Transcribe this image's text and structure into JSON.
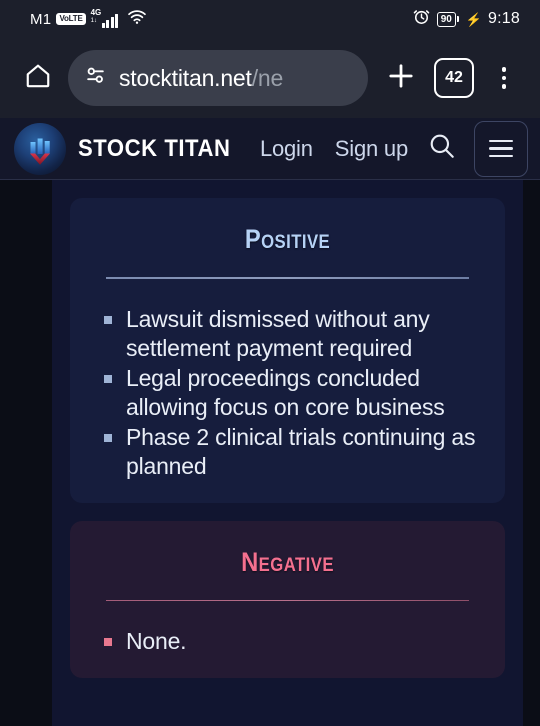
{
  "status_bar": {
    "carrier": "M1",
    "volte_badge": "VoLTE",
    "network_type": "4G",
    "network_sub": "1↓",
    "alarm_icon": "alarm-icon",
    "wifi_icon": "wifi-icon",
    "battery_level": "90",
    "charging_icon": "charging-bolt-icon",
    "time": "9:18"
  },
  "browser": {
    "home_icon": "home-icon",
    "site_settings_icon": "tune-icon",
    "url_main": "stocktitan.net",
    "url_dim": "/ne",
    "url_full": "stocktitan.net/ne",
    "new_tab_icon": "plus-icon",
    "tab_count": "42",
    "overflow_menu_icon": "three-dot-menu-icon"
  },
  "site_header": {
    "logo_icon": "stock-titan-logo-icon",
    "brand": "STOCK TITAN",
    "login_label": "Login",
    "signup_label": "Sign up",
    "search_icon": "search-icon",
    "menu_icon": "hamburger-menu-icon"
  },
  "cards": {
    "positive": {
      "title": "Positive",
      "accent": "#b6d2f5",
      "background": "#161d3d",
      "items": [
        "Lawsuit dismissed without any settlement payment required",
        "Legal proceedings concluded allowing focus on core business",
        "Phase 2 clinical trials continuing as planned"
      ]
    },
    "negative": {
      "title": "Negative",
      "accent": "#f4708f",
      "background": "#241a33",
      "items": [
        "None."
      ]
    }
  }
}
